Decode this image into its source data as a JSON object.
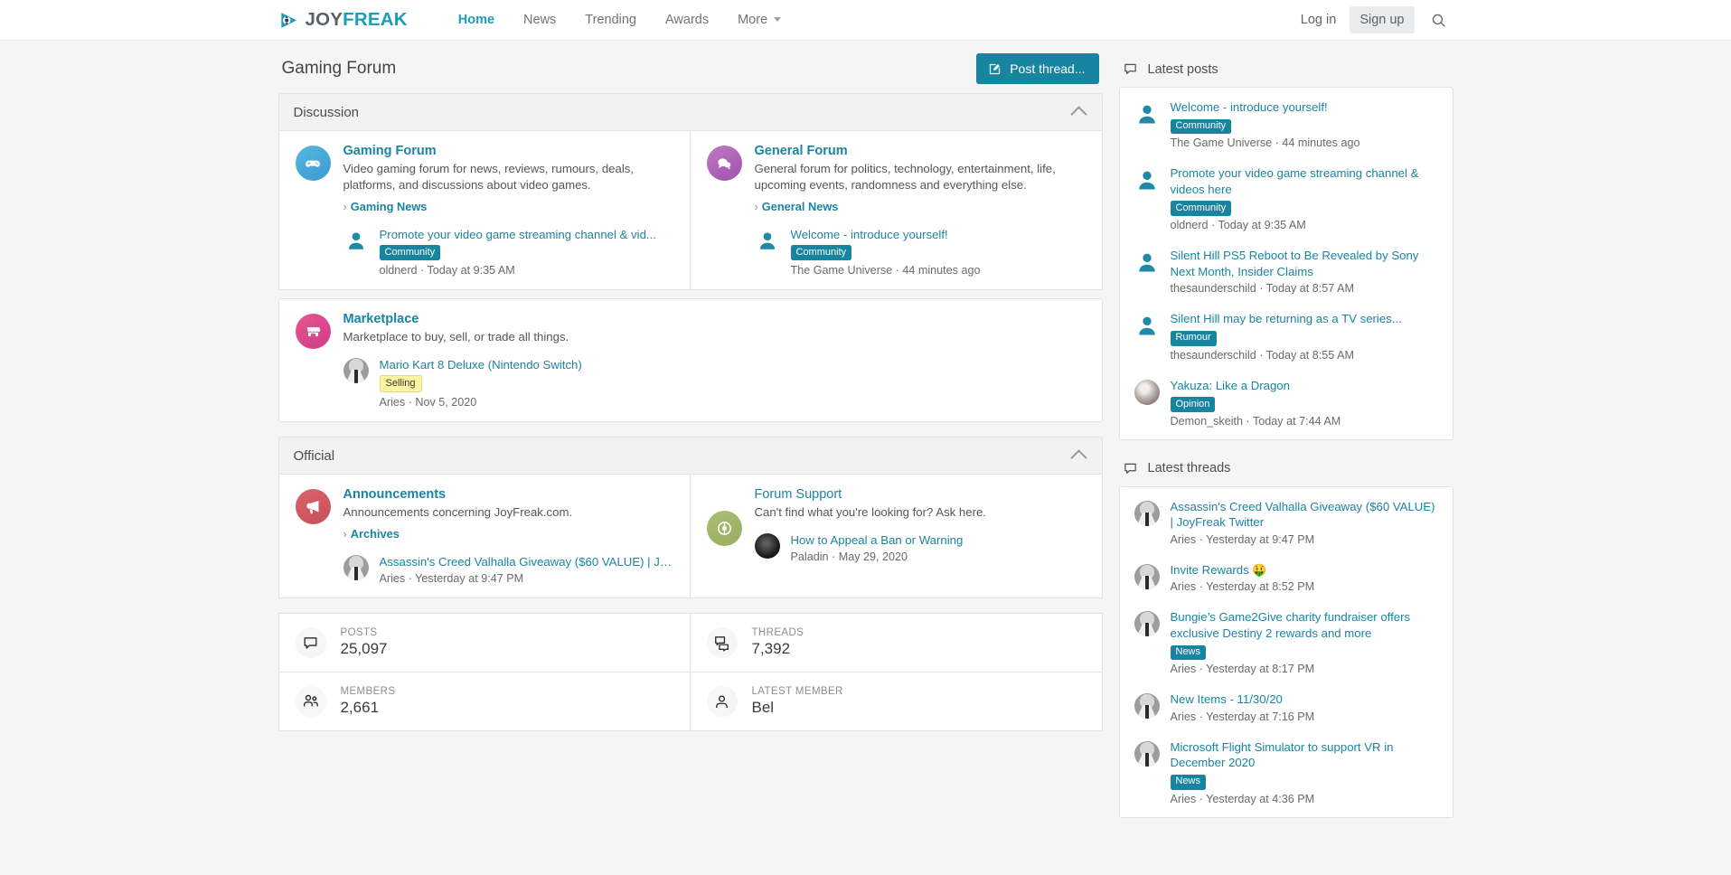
{
  "navbar": {
    "logo": {
      "icon": "play-logo-icon",
      "part1": "JOY",
      "part2": "FREAK"
    },
    "links": [
      {
        "label": "Home",
        "active": true
      },
      {
        "label": "News",
        "active": false
      },
      {
        "label": "Trending",
        "active": false
      },
      {
        "label": "Awards",
        "active": false
      },
      {
        "label": "More",
        "active": false,
        "has_caret": true
      }
    ],
    "login_label": "Log in",
    "signup_label": "Sign up",
    "search_icon": "search-icon"
  },
  "page": {
    "title": "Gaming Forum",
    "post_thread_label": "Post thread...",
    "post_thread_icon": "compose-icon"
  },
  "categories": [
    {
      "title": "Discussion",
      "nodes": [
        {
          "title": "Gaming Forum",
          "read": false,
          "icon": "gamepad-icon",
          "desc": "Video gaming forum for news, reviews, rumours, deals, platforms, and discussions about video games.",
          "sub_links": [
            "Gaming News"
          ],
          "latest": {
            "title": "Promote your video game streaming channel & vid...",
            "badge": "Community",
            "sub": "oldnerd · Today at 9:35 AM",
            "avatar": "silhouette"
          }
        },
        {
          "title": "General Forum",
          "read": false,
          "icon": "chat-bubbles-icon",
          "desc": "General forum for politics, technology, entertainment, life, upcoming events, randomness and everything else.",
          "sub_links": [
            "General News"
          ],
          "latest": {
            "title": "Welcome - introduce yourself!",
            "badge": "Community",
            "sub": "The Game Universe · 44 minutes ago",
            "avatar": "silhouette"
          }
        },
        {
          "title": "Marketplace",
          "read": false,
          "full": true,
          "icon": "store-icon",
          "desc": "Marketplace to buy, sell, or trade all things.",
          "sub_links": [],
          "latest": {
            "title": "Mario Kart 8 Deluxe (Nintendo Switch)",
            "badge": "Selling",
            "badge_style": "selling",
            "sub": "Aries · Nov 5, 2020",
            "avatar": "photo-grey"
          }
        }
      ]
    },
    {
      "title": "Official",
      "nodes": [
        {
          "title": "Announcements",
          "read": false,
          "icon": "megaphone-icon",
          "desc": "Announcements concerning JoyFreak.com.",
          "sub_links": [
            "Archives"
          ],
          "latest": {
            "title": "Assassin's Creed Valhalla Giveaway ($60 VALUE) | Jo...",
            "badge": "",
            "sub": "Aries · Yesterday at 9:47 PM",
            "avatar": "photo-grey"
          }
        },
        {
          "title": "Forum Support",
          "read": true,
          "icon": "lifering-icon",
          "desc": "Can't find what you're looking for? Ask here.",
          "sub_links": [],
          "latest": {
            "title": "How to Appeal a Ban or Warning",
            "badge": "",
            "sub": "Paladin · May 29, 2020",
            "avatar": "photo-dark"
          }
        }
      ]
    }
  ],
  "stats": [
    {
      "label": "POSTS",
      "value": "25,097",
      "icon": "comment-icon"
    },
    {
      "label": "THREADS",
      "value": "7,392",
      "icon": "comments-icon"
    },
    {
      "label": "MEMBERS",
      "value": "2,661",
      "icon": "users-icon"
    },
    {
      "label": "LATEST MEMBER",
      "value": "Bel",
      "icon": "user-icon"
    }
  ],
  "sidebar": [
    {
      "title": "Latest posts",
      "icon": "comment-icon",
      "items": [
        {
          "title": "Welcome - introduce yourself!",
          "badge": "Community",
          "sub": "The Game Universe · 44 minutes ago",
          "avatar": "silhouette"
        },
        {
          "title": "Promote your video game streaming channel & videos here",
          "badge": "Community",
          "sub": "oldnerd · Today at 9:35 AM",
          "avatar": "silhouette"
        },
        {
          "title": "Silent Hill PS5 Reboot to Be Revealed by Sony Next Month, Insider Claims",
          "badge": "",
          "sub": "thesaunderschild · Today at 8:57 AM",
          "avatar": "silhouette"
        },
        {
          "title": "Silent Hill may be returning as a TV series...",
          "badge": "Rumour",
          "sub": "thesaunderschild · Today at 8:55 AM",
          "avatar": "silhouette"
        },
        {
          "title": "Yakuza: Like a Dragon",
          "badge": "Opinion",
          "sub": "Demon_skeith · Today at 7:44 AM",
          "avatar": "photo-demon"
        }
      ]
    },
    {
      "title": "Latest threads",
      "icon": "comment-icon",
      "items": [
        {
          "title": "Assassin's Creed Valhalla Giveaway ($60 VALUE) | JoyFreak Twitter",
          "badge": "",
          "sub": "Aries · Yesterday at 9:47 PM",
          "avatar": "photo-grey"
        },
        {
          "title": "Invite Rewards",
          "emoji": "🤑",
          "badge": "",
          "sub": "Aries · Yesterday at 8:52 PM",
          "avatar": "photo-grey"
        },
        {
          "title": "Bungie’s Game2Give charity fundraiser offers exclusive Destiny 2 rewards and more",
          "badge": "News",
          "sub": "Aries · Yesterday at 8:17 PM",
          "avatar": "photo-grey"
        },
        {
          "title": "New Items - 11/30/20",
          "badge": "",
          "sub": "Aries · Yesterday at 7:16 PM",
          "avatar": "photo-grey"
        },
        {
          "title": "Microsoft Flight Simulator to support VR in December 2020",
          "badge": "News",
          "sub": "Aries · Yesterday at 4:36 PM",
          "avatar": "photo-grey"
        }
      ]
    }
  ],
  "colors": {
    "accent": "#1784a0",
    "link": "#1b84a3",
    "page_bg": "#f5f5f5"
  }
}
